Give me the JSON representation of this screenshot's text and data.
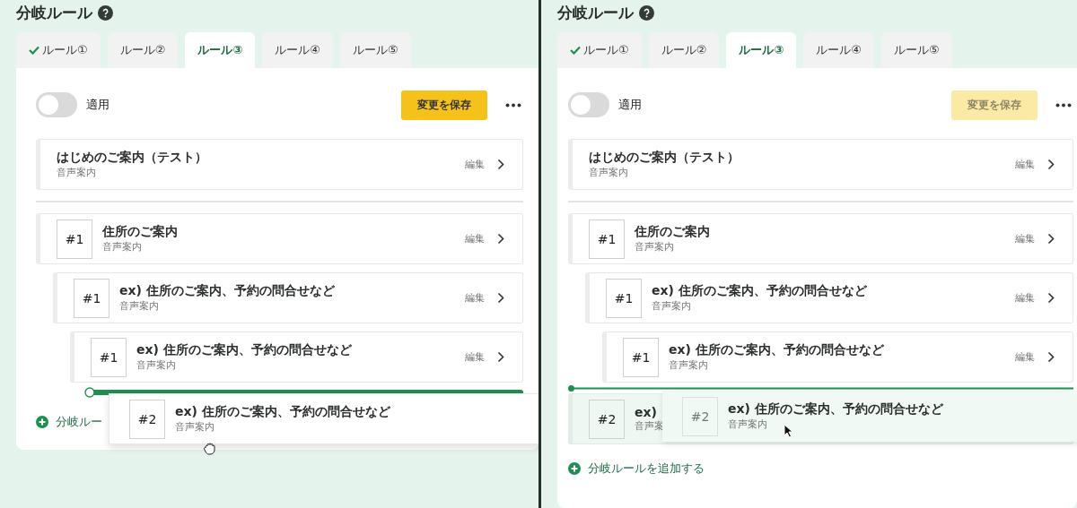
{
  "panels": [
    {
      "title": "分岐ルール",
      "tabs": [
        {
          "label": "ルール①",
          "selected": false,
          "checked": true
        },
        {
          "label": "ルール②",
          "selected": false,
          "checked": false
        },
        {
          "label": "ルール③",
          "selected": true,
          "checked": false
        },
        {
          "label": "ルール④",
          "selected": false,
          "checked": false
        },
        {
          "label": "ルール⑤",
          "selected": false,
          "checked": false
        }
      ],
      "toggle": {
        "label": "適用",
        "on": false
      },
      "save_button": {
        "label": "変更を保存",
        "disabled": false
      },
      "intro": {
        "title": "はじめのご案内（テスト）",
        "subtitle": "音声案内",
        "edit": "編集"
      },
      "branches": [
        {
          "number": "#1",
          "title": "住所のご案内",
          "subtitle": "音声案内",
          "edit": "編集",
          "children": [
            {
              "number": "#1",
              "title": "ex) 住所のご案内、予約の問合せなど",
              "subtitle": "音声案内",
              "edit": "編集",
              "children": [
                {
                  "number": "#1",
                  "title": "ex) 住所のご案内、予約の問合せなど",
                  "subtitle": "音声案内",
                  "edit": "編集"
                }
              ]
            }
          ]
        }
      ],
      "drop_indicator": {
        "kind": "bar"
      },
      "add_link": "分岐ルー",
      "drag_card": {
        "number": "#2",
        "title": "ex) 住所のご案内、予約の問合せなど",
        "subtitle": "音声案内",
        "translucent": false,
        "grabbing": true
      }
    },
    {
      "title": "分岐ルール",
      "tabs": [
        {
          "label": "ルール①",
          "selected": false,
          "checked": true
        },
        {
          "label": "ルール②",
          "selected": false,
          "checked": false
        },
        {
          "label": "ルール③",
          "selected": true,
          "checked": false
        },
        {
          "label": "ルール④",
          "selected": false,
          "checked": false
        },
        {
          "label": "ルール⑤",
          "selected": false,
          "checked": false
        }
      ],
      "toggle": {
        "label": "適用",
        "on": false
      },
      "save_button": {
        "label": "変更を保存",
        "disabled": true
      },
      "intro": {
        "title": "はじめのご案内（テスト）",
        "subtitle": "音声案内",
        "edit": "編集"
      },
      "branches": [
        {
          "number": "#1",
          "title": "住所のご案内",
          "subtitle": "音声案内",
          "edit": "編集",
          "children": [
            {
              "number": "#1",
              "title": "ex) 住所のご案内、予約の問合せなど",
              "subtitle": "音声案内",
              "edit": "編集",
              "children": [
                {
                  "number": "#1",
                  "title": "ex) 住所のご案内、予約の問合せなど",
                  "subtitle": "音声案内",
                  "edit": "編集"
                }
              ]
            }
          ]
        }
      ],
      "drop_indicator": {
        "kind": "line"
      },
      "ghost_row": {
        "number": "#2",
        "title": "ex)",
        "subtitle": "音声案"
      },
      "add_link": "分岐ルールを追加する",
      "drag_card": {
        "number": "#2",
        "title": "ex) 住所のご案内、予約の問合せなど",
        "subtitle": "音声案内",
        "translucent": true,
        "grabbing": false
      }
    }
  ]
}
